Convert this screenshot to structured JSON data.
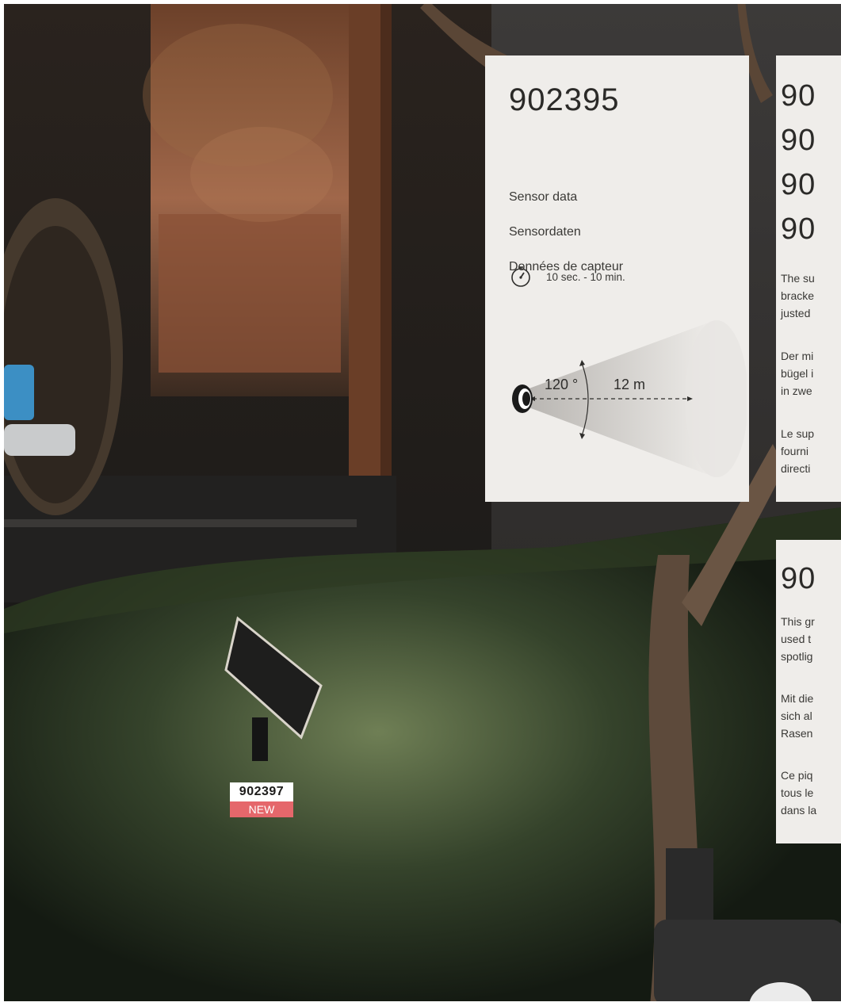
{
  "sensor_card": {
    "model": "902395",
    "lines": [
      "Sensor data",
      "Sensordaten",
      "Données de capteur"
    ],
    "timer_icon": "stopwatch-icon",
    "timer_range": "10 sec. - 10 min.",
    "angle_label": "120 °",
    "distance_label": "12 m",
    "sensor_icon": "motion-sensor-icon"
  },
  "right_card_top": {
    "models": [
      "90",
      "90",
      "90",
      "90"
    ],
    "paragraphs": [
      [
        "The su",
        "bracke",
        "justed"
      ],
      [
        "Der mi",
        "bügel i",
        "in zwe"
      ],
      [
        "Le sup",
        "fourni",
        "directi"
      ]
    ]
  },
  "right_card_bottom": {
    "model": "90",
    "paragraphs": [
      [
        "This gr",
        "used t",
        "spotlig"
      ],
      [
        "Mit die",
        "sich al",
        "Rasen"
      ],
      [
        "Ce piq",
        "tous le",
        "dans la"
      ]
    ]
  },
  "product_badge": {
    "code": "902397",
    "tag": "NEW",
    "tag_color": "#e5676b"
  }
}
